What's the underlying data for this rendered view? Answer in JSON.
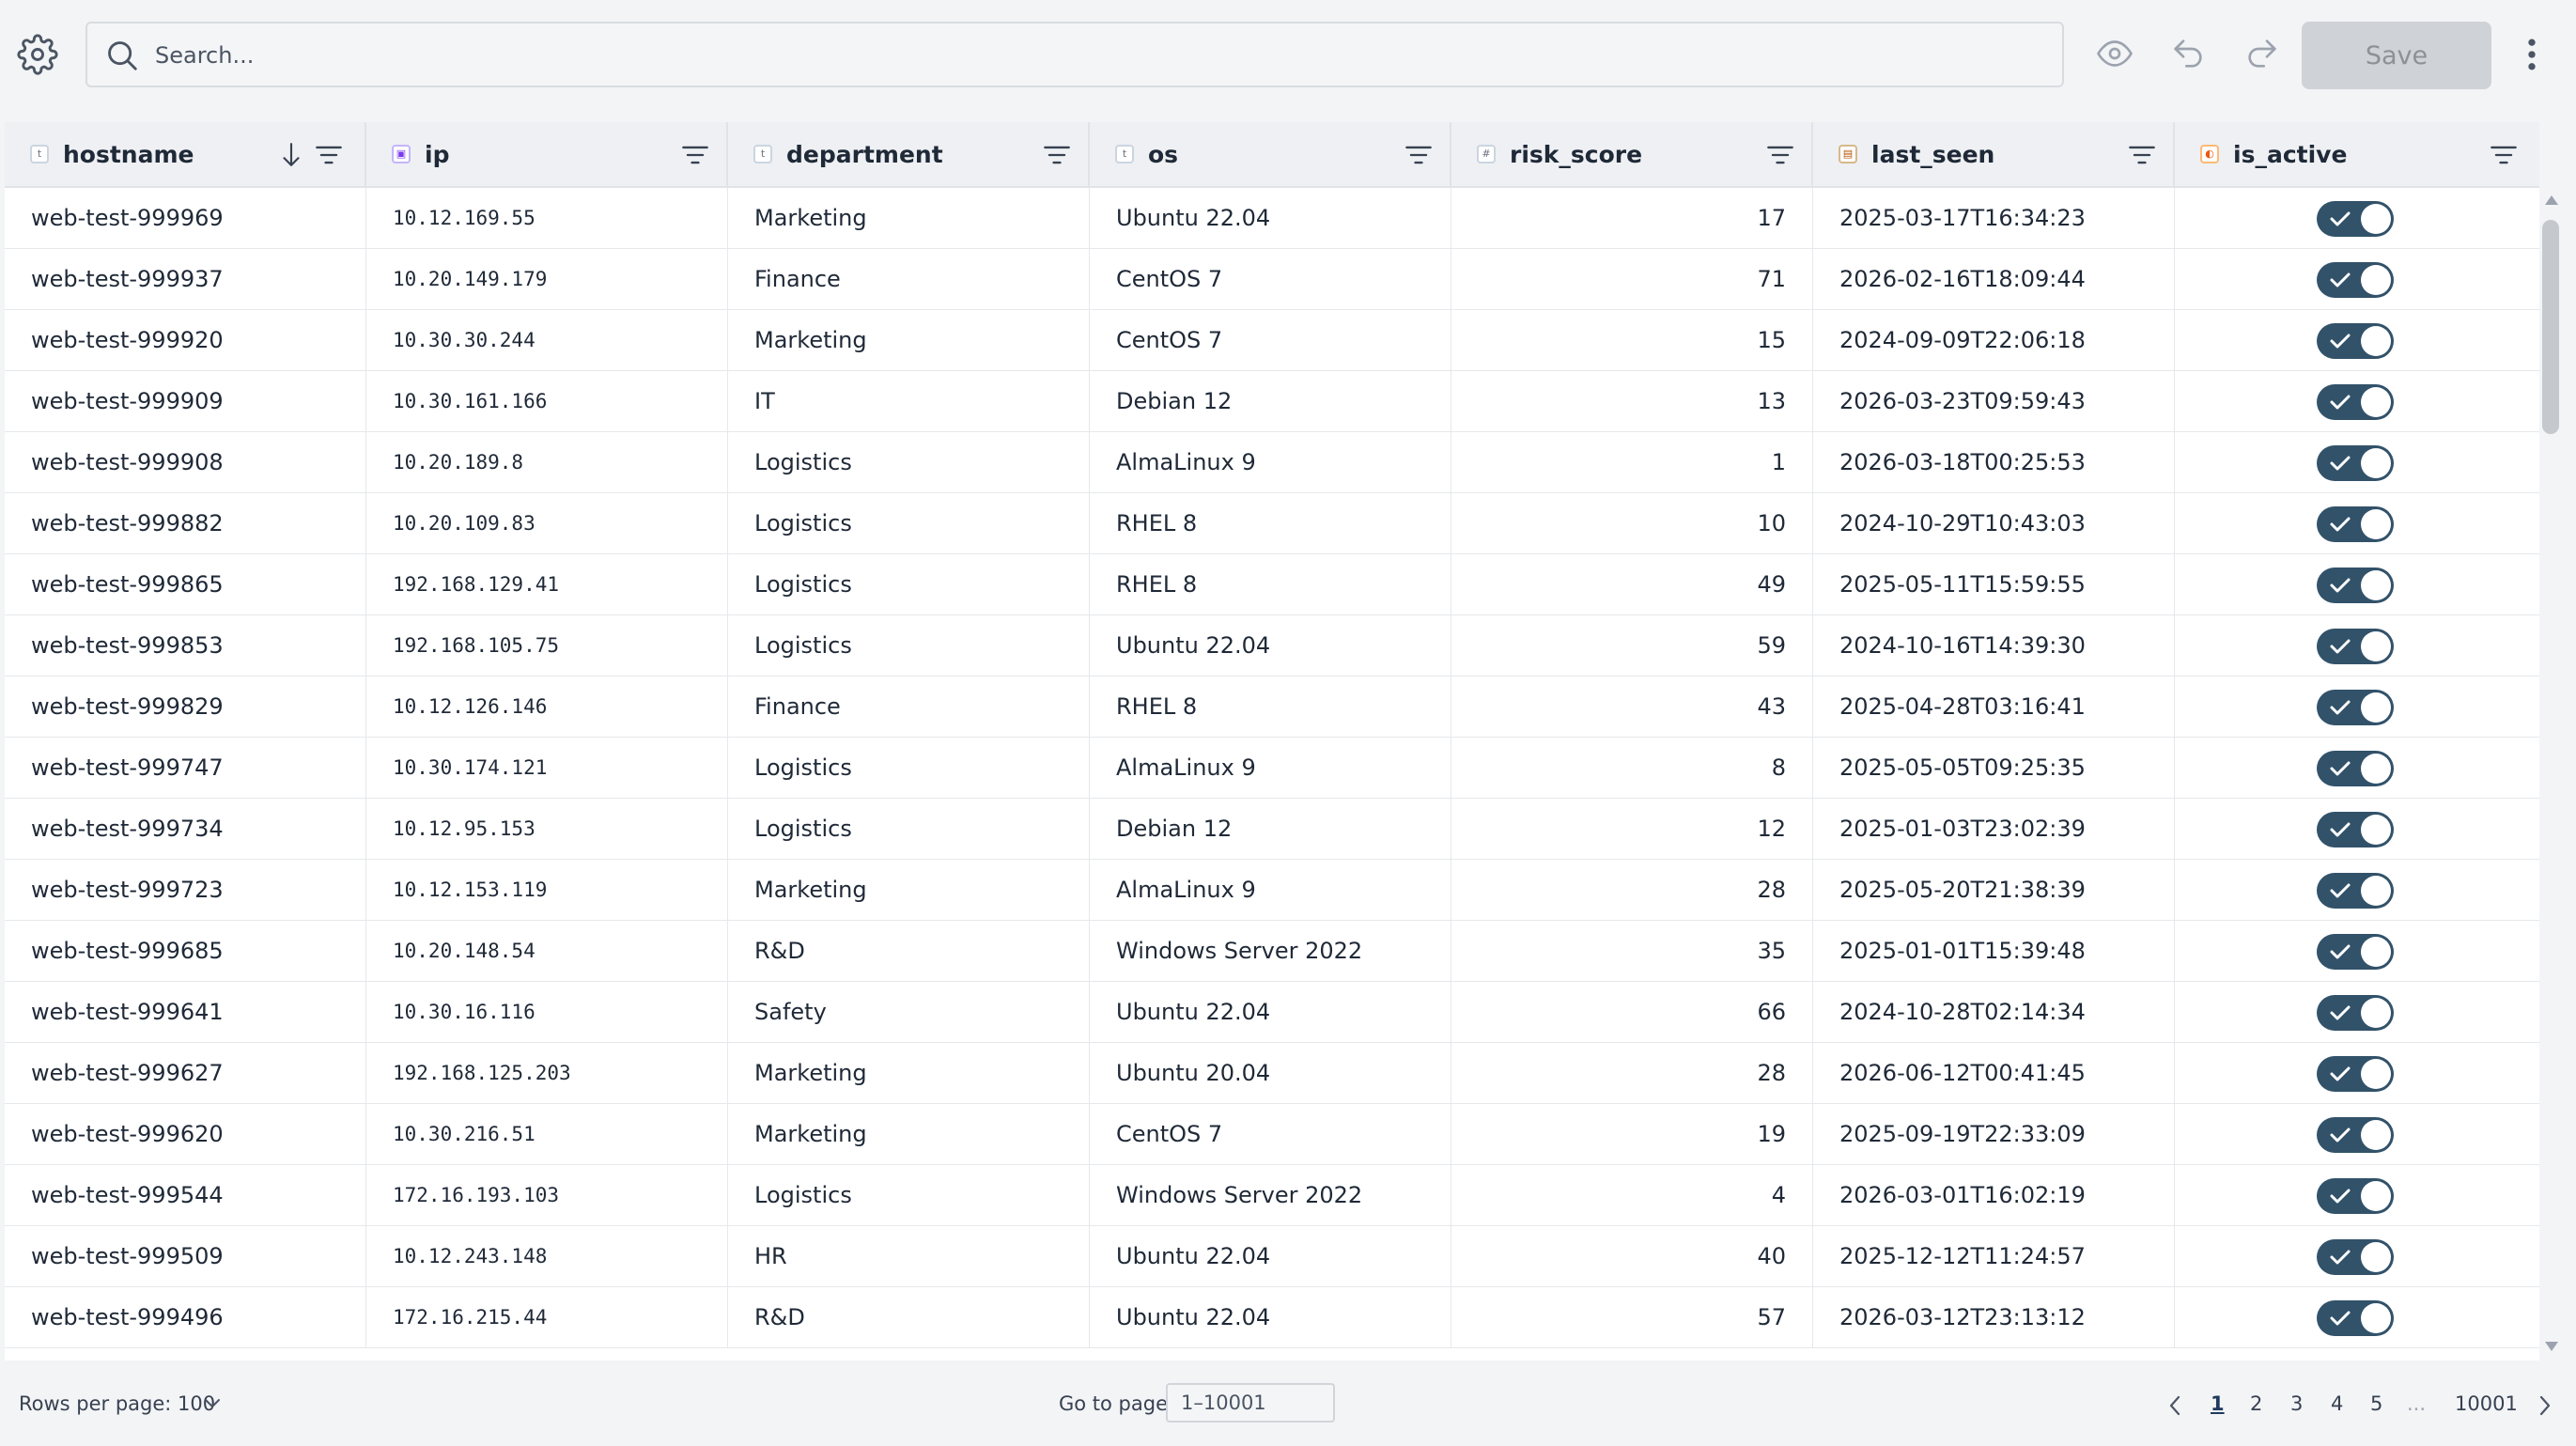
{
  "toolbar": {
    "search_placeholder": "Search...",
    "save_label": "Save",
    "icons": [
      "gear-icon",
      "search-icon",
      "eye-icon",
      "undo-icon",
      "redo-icon",
      "kebab-menu-icon"
    ]
  },
  "table": {
    "columns": [
      {
        "key": "hostname",
        "label": "hostname",
        "type_icon": "t",
        "sorted": "descending"
      },
      {
        "key": "ip",
        "label": "ip",
        "type_icon": "ip"
      },
      {
        "key": "department",
        "label": "department",
        "type_icon": "t"
      },
      {
        "key": "os",
        "label": "os",
        "type_icon": "t"
      },
      {
        "key": "risk_score",
        "label": "risk_score",
        "type_icon": "#"
      },
      {
        "key": "last_seen",
        "label": "last_seen",
        "type_icon": "date"
      },
      {
        "key": "is_active",
        "label": "is_active",
        "type_icon": "bool"
      }
    ],
    "rows": [
      {
        "hostname": "web-test-999969",
        "ip": "10.12.169.55",
        "department": "Marketing",
        "os": "Ubuntu 22.04",
        "risk_score": "17",
        "last_seen": "2025-03-17T16:34:23",
        "is_active": true
      },
      {
        "hostname": "web-test-999937",
        "ip": "10.20.149.179",
        "department": "Finance",
        "os": "CentOS 7",
        "risk_score": "71",
        "last_seen": "2026-02-16T18:09:44",
        "is_active": true
      },
      {
        "hostname": "web-test-999920",
        "ip": "10.30.30.244",
        "department": "Marketing",
        "os": "CentOS 7",
        "risk_score": "15",
        "last_seen": "2024-09-09T22:06:18",
        "is_active": true
      },
      {
        "hostname": "web-test-999909",
        "ip": "10.30.161.166",
        "department": "IT",
        "os": "Debian 12",
        "risk_score": "13",
        "last_seen": "2026-03-23T09:59:43",
        "is_active": true
      },
      {
        "hostname": "web-test-999908",
        "ip": "10.20.189.8",
        "department": "Logistics",
        "os": "AlmaLinux 9",
        "risk_score": "1",
        "last_seen": "2026-03-18T00:25:53",
        "is_active": true
      },
      {
        "hostname": "web-test-999882",
        "ip": "10.20.109.83",
        "department": "Logistics",
        "os": "RHEL 8",
        "risk_score": "10",
        "last_seen": "2024-10-29T10:43:03",
        "is_active": true
      },
      {
        "hostname": "web-test-999865",
        "ip": "192.168.129.41",
        "department": "Logistics",
        "os": "RHEL 8",
        "risk_score": "49",
        "last_seen": "2025-05-11T15:59:55",
        "is_active": true
      },
      {
        "hostname": "web-test-999853",
        "ip": "192.168.105.75",
        "department": "Logistics",
        "os": "Ubuntu 22.04",
        "risk_score": "59",
        "last_seen": "2024-10-16T14:39:30",
        "is_active": true
      },
      {
        "hostname": "web-test-999829",
        "ip": "10.12.126.146",
        "department": "Finance",
        "os": "RHEL 8",
        "risk_score": "43",
        "last_seen": "2025-04-28T03:16:41",
        "is_active": true
      },
      {
        "hostname": "web-test-999747",
        "ip": "10.30.174.121",
        "department": "Logistics",
        "os": "AlmaLinux 9",
        "risk_score": "8",
        "last_seen": "2025-05-05T09:25:35",
        "is_active": true
      },
      {
        "hostname": "web-test-999734",
        "ip": "10.12.95.153",
        "department": "Logistics",
        "os": "Debian 12",
        "risk_score": "12",
        "last_seen": "2025-01-03T23:02:39",
        "is_active": true
      },
      {
        "hostname": "web-test-999723",
        "ip": "10.12.153.119",
        "department": "Marketing",
        "os": "AlmaLinux 9",
        "risk_score": "28",
        "last_seen": "2025-05-20T21:38:39",
        "is_active": true
      },
      {
        "hostname": "web-test-999685",
        "ip": "10.20.148.54",
        "department": "R&D",
        "os": "Windows Server 2022",
        "risk_score": "35",
        "last_seen": "2025-01-01T15:39:48",
        "is_active": true
      },
      {
        "hostname": "web-test-999641",
        "ip": "10.30.16.116",
        "department": "Safety",
        "os": "Ubuntu 22.04",
        "risk_score": "66",
        "last_seen": "2024-10-28T02:14:34",
        "is_active": true
      },
      {
        "hostname": "web-test-999627",
        "ip": "192.168.125.203",
        "department": "Marketing",
        "os": "Ubuntu 20.04",
        "risk_score": "28",
        "last_seen": "2026-06-12T00:41:45",
        "is_active": true
      },
      {
        "hostname": "web-test-999620",
        "ip": "10.30.216.51",
        "department": "Marketing",
        "os": "CentOS 7",
        "risk_score": "19",
        "last_seen": "2025-09-19T22:33:09",
        "is_active": true
      },
      {
        "hostname": "web-test-999544",
        "ip": "172.16.193.103",
        "department": "Logistics",
        "os": "Windows Server 2022",
        "risk_score": "4",
        "last_seen": "2026-03-01T16:02:19",
        "is_active": true
      },
      {
        "hostname": "web-test-999509",
        "ip": "10.12.243.148",
        "department": "HR",
        "os": "Ubuntu 22.04",
        "risk_score": "40",
        "last_seen": "2025-12-12T11:24:57",
        "is_active": true
      },
      {
        "hostname": "web-test-999496",
        "ip": "172.16.215.44",
        "department": "R&D",
        "os": "Ubuntu 22.04",
        "risk_score": "57",
        "last_seen": "2026-03-12T23:13:12",
        "is_active": true
      }
    ]
  },
  "footer": {
    "rows_per_page_label": "Rows per page: 100",
    "goto_label": "Go to page",
    "goto_placeholder": "1–10001",
    "pages": [
      "1",
      "2",
      "3",
      "4",
      "5"
    ],
    "ellipsis": "...",
    "last_page": "10001",
    "current_page": "1"
  },
  "colors": {
    "toggle_on": "#32526a",
    "save_disabled_bg": "#cfd2d6",
    "header_bg": "#eef0f3",
    "page_bg": "#f3f4f6"
  }
}
